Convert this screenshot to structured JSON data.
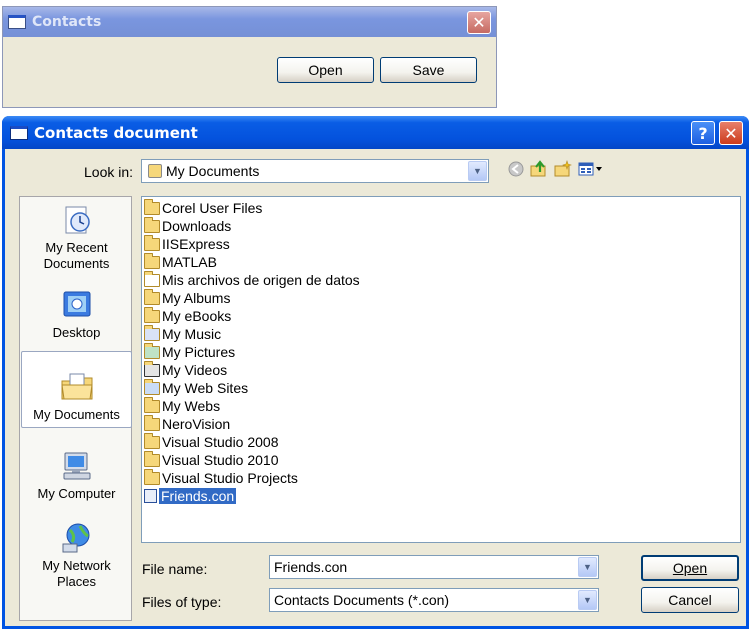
{
  "small_window": {
    "title": "Contacts",
    "close_glyph": "✕",
    "open_label": "Open",
    "save_label": "Save"
  },
  "dialog": {
    "title": "Contacts document",
    "help_glyph": "?",
    "close_glyph": "✕",
    "look_in_label": "Look in:",
    "look_in_value": "My Documents",
    "places": [
      {
        "label": "My Recent Documents",
        "icon": "recent-documents-icon"
      },
      {
        "label": "Desktop",
        "icon": "desktop-icon"
      },
      {
        "label": "My Documents",
        "icon": "my-documents-icon",
        "selected": true
      },
      {
        "label": "My Computer",
        "icon": "computer-icon"
      },
      {
        "label": "My Network Places",
        "icon": "network-icon"
      }
    ],
    "files": [
      {
        "name": "Corel User Files",
        "icon": "folder"
      },
      {
        "name": "Downloads",
        "icon": "folder"
      },
      {
        "name": "IISExpress",
        "icon": "folder"
      },
      {
        "name": "MATLAB",
        "icon": "folder"
      },
      {
        "name": "Mis archivos de origen de datos",
        "icon": "special-folder"
      },
      {
        "name": "My Albums",
        "icon": "folder"
      },
      {
        "name": "My eBooks",
        "icon": "folder"
      },
      {
        "name": "My Music",
        "icon": "music-folder"
      },
      {
        "name": "My Pictures",
        "icon": "pictures-folder"
      },
      {
        "name": "My Videos",
        "icon": "videos-folder"
      },
      {
        "name": "My Web Sites",
        "icon": "web-folder"
      },
      {
        "name": "My Webs",
        "icon": "folder"
      },
      {
        "name": "NeroVision",
        "icon": "folder"
      },
      {
        "name": "Visual Studio 2008",
        "icon": "folder"
      },
      {
        "name": "Visual Studio 2010",
        "icon": "folder"
      },
      {
        "name": "Visual Studio Projects",
        "icon": "folder"
      },
      {
        "name": "Friends.con",
        "icon": "file",
        "selected": true
      }
    ],
    "file_name_label": "File name:",
    "file_name_value": "Friends.con",
    "file_type_label": "Files of type:",
    "file_type_value": "Contacts Documents (*.con)",
    "open_label": "Open",
    "cancel_label": "Cancel",
    "toolbar_icons": [
      "back-icon",
      "up-folder-icon",
      "new-folder-icon",
      "view-menu-icon"
    ]
  },
  "colors": {
    "titlebar_active": "#0452dd",
    "titlebar_inactive": "#7a96df",
    "dialog_bg": "#ece9d8",
    "selection": "#316ac5"
  }
}
